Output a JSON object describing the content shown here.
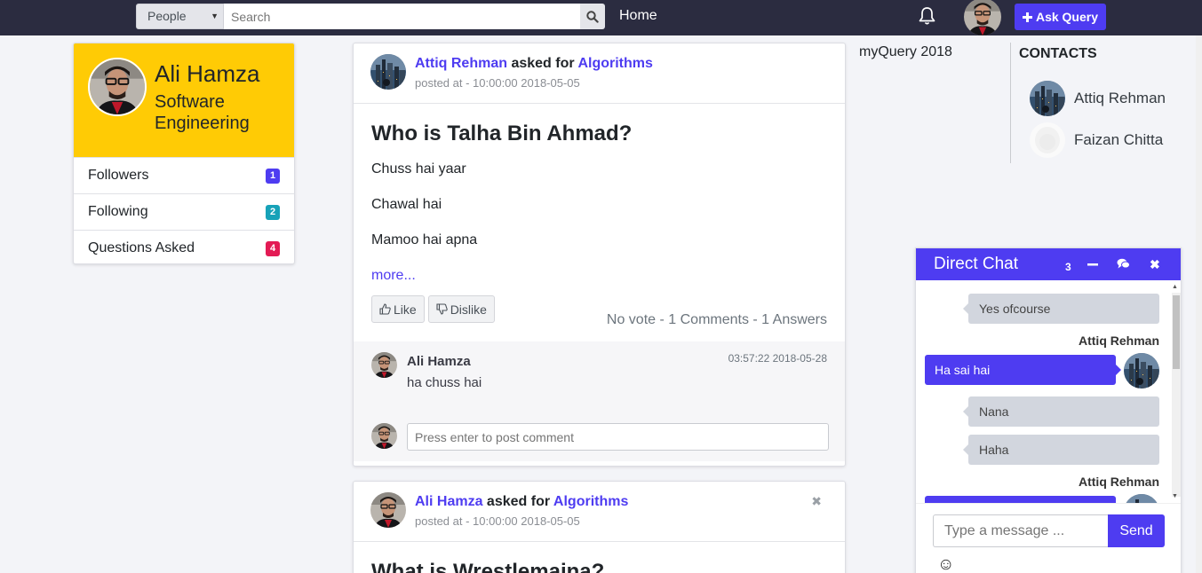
{
  "navbar": {
    "search_scope": "People",
    "search_placeholder": "Search",
    "home_label": "Home",
    "ask_label": "Ask Query",
    "icons": [
      "search-icon",
      "bell-icon",
      "plus-icon"
    ]
  },
  "profile": {
    "name": "Ali Hamza",
    "role": "Software Engineering",
    "stats": [
      {
        "label": "Followers",
        "count": "1",
        "color": "#4e3cf1"
      },
      {
        "label": "Following",
        "count": "2",
        "color": "#17a2b8"
      },
      {
        "label": "Questions Asked",
        "count": "4",
        "color": "#e31b54"
      }
    ]
  },
  "posts": [
    {
      "author": "Attiq Rehman",
      "asked_for": "asked for",
      "topic": "Algorithms",
      "meta": "posted at - 10:00:00 2018-05-05",
      "question": "Who is Talha Bin Ahmad?",
      "answers": [
        "Chuss hai yaar",
        "Chawal hai",
        "Mamoo hai apna"
      ],
      "more": "more...",
      "like": "Like",
      "dislike": "Dislike",
      "stats": "No vote - 1 Comments - 1 Answers",
      "comment": {
        "name": "Ali Hamza",
        "text": "ha chuss hai",
        "time": "03:57:22 2018-05-28"
      },
      "comment_placeholder": "Press enter to post comment"
    },
    {
      "author": "Ali Hamza",
      "asked_for": "asked for",
      "topic": "Algorithms",
      "meta": "posted at - 10:00:00 2018-05-05",
      "question": "What is Wrestlemaina?",
      "close": "✖"
    }
  ],
  "brand": "myQuery 2018",
  "contacts": {
    "title": "CONTACTS",
    "items": [
      "Attiq Rehman",
      "Faizan Chitta"
    ]
  },
  "chat": {
    "title": "Direct Chat",
    "count": "3",
    "messages": [
      {
        "text": "Yes ofcourse"
      },
      {
        "sender": "Attiq Rehman",
        "text": "Ha sai hai"
      },
      {
        "text": "Nana"
      },
      {
        "text": "Haha"
      },
      {
        "sender": "Attiq Rehman",
        "text": ""
      }
    ],
    "input_placeholder": "Type a message ...",
    "send_label": "Send",
    "smiley": "☺"
  }
}
